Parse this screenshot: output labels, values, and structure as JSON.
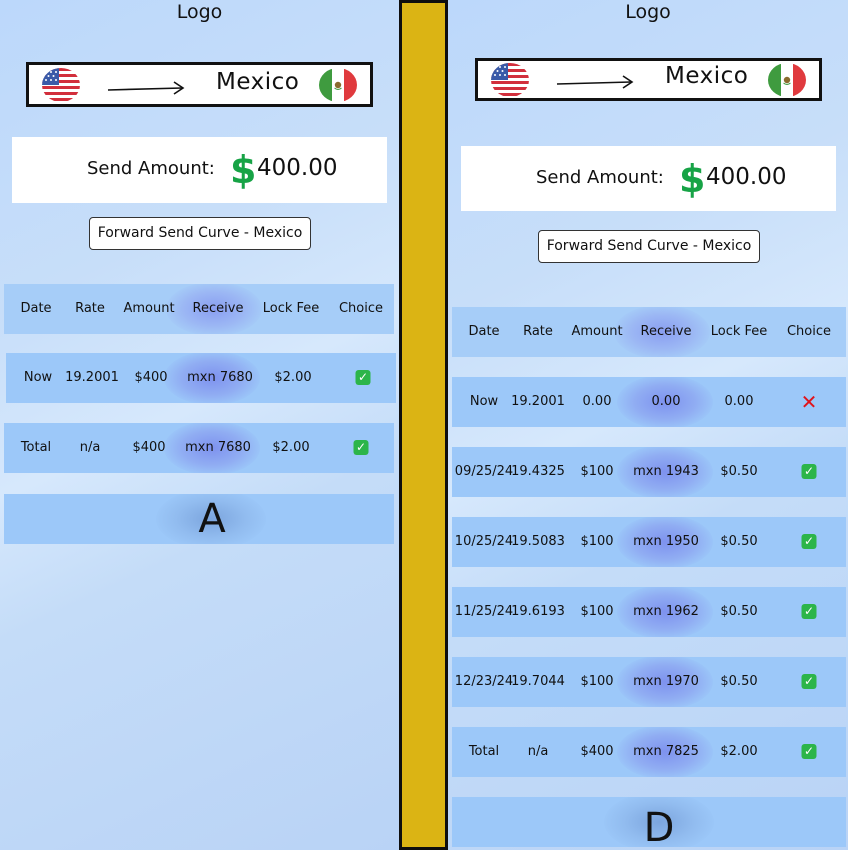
{
  "left": {
    "logo": "Logo",
    "route": {
      "from_flag": "usa-flag-icon",
      "to_flag": "mexico-flag-icon",
      "country": "Mexico"
    },
    "send": {
      "label": "Send Amount:",
      "currency_symbol": "$",
      "amount": "400.00"
    },
    "curve_button": "Forward Send Curve - Mexico",
    "table": {
      "headers": [
        "Date",
        "Rate",
        "Amount",
        "Receive",
        "Lock Fee",
        "Choice"
      ],
      "rows": [
        {
          "date": "Now",
          "rate": "19.2001",
          "amount": "$400",
          "receive": "mxn 7680",
          "fee": "$2.00",
          "choice": "check"
        },
        {
          "date": "Total",
          "rate": "n/a",
          "amount": "$400",
          "receive": "mxn 7680",
          "fee": "$2.00",
          "choice": "check"
        }
      ]
    },
    "variant_label": "A"
  },
  "right": {
    "logo": "Logo",
    "route": {
      "from_flag": "usa-flag-icon",
      "to_flag": "mexico-flag-icon",
      "country": "Mexico"
    },
    "send": {
      "label": "Send Amount:",
      "currency_symbol": "$",
      "amount": "400.00"
    },
    "curve_button": "Forward Send Curve - Mexico",
    "table": {
      "headers": [
        "Date",
        "Rate",
        "Amount",
        "Receive",
        "Lock Fee",
        "Choice"
      ],
      "rows": [
        {
          "date": "Now",
          "rate": "19.2001",
          "amount": "0.00",
          "receive": "0.00",
          "fee": "0.00",
          "choice": "cross"
        },
        {
          "date": "09/25/24",
          "rate": "19.4325",
          "amount": "$100",
          "receive": "mxn 1943",
          "fee": "$0.50",
          "choice": "check"
        },
        {
          "date": "10/25/24",
          "rate": "19.5083",
          "amount": "$100",
          "receive": "mxn 1950",
          "fee": "$0.50",
          "choice": "check"
        },
        {
          "date": "11/25/24",
          "rate": "19.6193",
          "amount": "$100",
          "receive": "mxn 1962",
          "fee": "$0.50",
          "choice": "check"
        },
        {
          "date": "12/23/24",
          "rate": "19.7044",
          "amount": "$100",
          "receive": "mxn 1970",
          "fee": "$0.50",
          "choice": "check"
        },
        {
          "date": "Total",
          "rate": "n/a",
          "amount": "$400",
          "receive": "mxn 7825",
          "fee": "$2.00",
          "choice": "check"
        }
      ]
    },
    "variant_label": "D"
  },
  "colors": {
    "divider": "#dbb414",
    "row_background": "#9cc8f9",
    "dollar_sign": "#17a346",
    "check": "#2cb54a",
    "cross": "#e0141c"
  }
}
